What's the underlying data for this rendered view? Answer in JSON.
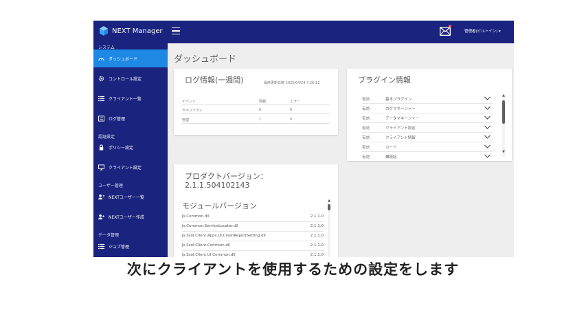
{
  "brand": {
    "name": "NEXT Manager"
  },
  "header": {
    "user": "管理者(ビルトイン) ▾"
  },
  "sidebar": {
    "sections": {
      "system": "システム",
      "auth": "認証設定",
      "users": "ユーザー管理",
      "data": "データ管理"
    },
    "items": [
      {
        "label": "ダッシュボード"
      },
      {
        "label": "コントロール設定"
      },
      {
        "label": "クライアント一覧"
      },
      {
        "label": "ログ管理"
      },
      {
        "label": "ポリシー設定"
      },
      {
        "label": "クライアント設定"
      },
      {
        "label": "NEXTユーザー一覧"
      },
      {
        "label": "NEXTユーザー作成"
      },
      {
        "label": "ジョブ管理"
      }
    ]
  },
  "main": {
    "title": "ダッシュボード",
    "log": {
      "title": "ログ情報(一週間)",
      "updated": "最終更新日時 2025/04/24 7:26:12",
      "headers": [
        "イベント",
        "情報",
        "エラー"
      ],
      "rows": [
        [
          "セキュリティ",
          "0",
          "0"
        ],
        [
          "管理",
          "1",
          "0"
        ]
      ]
    },
    "plugins": {
      "title": "プラグイン情報",
      "rows": [
        {
          "status": "有効",
          "name": "基本プラグイン"
        },
        {
          "status": "有効",
          "name": "ログマネージャー"
        },
        {
          "status": "有効",
          "name": "データマネージャー"
        },
        {
          "status": "有効",
          "name": "クライアント設定"
        },
        {
          "status": "有効",
          "name": "クライアント情報"
        },
        {
          "status": "有効",
          "name": "カード"
        },
        {
          "status": "有効",
          "name": "難読話"
        }
      ]
    },
    "product": {
      "title": "プロダクトバージョン：",
      "version": "2.1.1.504102143"
    },
    "modules": {
      "title": "モジュールバージョン",
      "rows": [
        {
          "name": "Js.Common.dll",
          "version": "2.1.1.0"
        },
        {
          "name": "Js.Common.ServiceLocator.dll",
          "version": "2.1.1.0"
        },
        {
          "name": "Js.Ssol.Client.Apps.UI.CrashReportSetting.dll",
          "version": "2.1.1.0"
        },
        {
          "name": "Js.Ssol.Client.Common.dll",
          "version": "2.1.1.0"
        },
        {
          "name": "Js.Ssol.Client.UI.Common.dll",
          "version": "2.1.1.0"
        }
      ]
    }
  },
  "caption": "次にクライアントを使用するための設定をします",
  "colors": {
    "sidebar": "#1a237e",
    "active": "#1e88e5",
    "background": "#eeeeee"
  }
}
